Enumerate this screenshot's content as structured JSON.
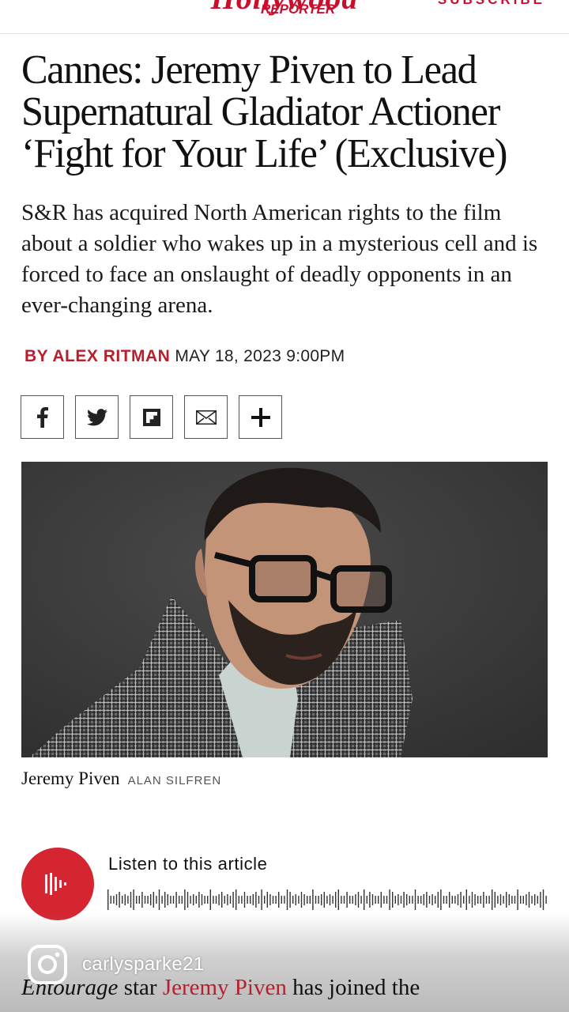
{
  "header": {
    "logo_script": "Hollywood",
    "logo_sub": "REPORTER",
    "subscribe_label": "SUBSCRIBE",
    "brand_color": "#c8102e"
  },
  "article": {
    "headline": "Cannes: Jeremy Piven to Lead Supernatural Gladiator Actioner ‘Fight for Your Life’ (Exclusive)",
    "dek": "S&R has acquired North American rights to the film about a soldier who wakes up in a mysterious cell and is forced to face an onslaught of deadly opponents in an ever-changing arena.",
    "byline": {
      "author": "BY ALEX RITMAN",
      "date": "MAY 18, 2023 9:00PM"
    },
    "share_icons": [
      "facebook-icon",
      "twitter-icon",
      "flipboard-icon",
      "email-icon",
      "plus-icon"
    ],
    "photo": {
      "caption_name": "Jeremy Piven",
      "caption_credit": "ALAN SILFREN"
    },
    "audio": {
      "label": "Listen to this article"
    },
    "body": {
      "em": "Entourage",
      "text1": " star ",
      "link": "Jeremy Piven",
      "text2": " has joined the"
    }
  },
  "overlay": {
    "username": "carlysparke21",
    "icon": "instagram-icon"
  }
}
